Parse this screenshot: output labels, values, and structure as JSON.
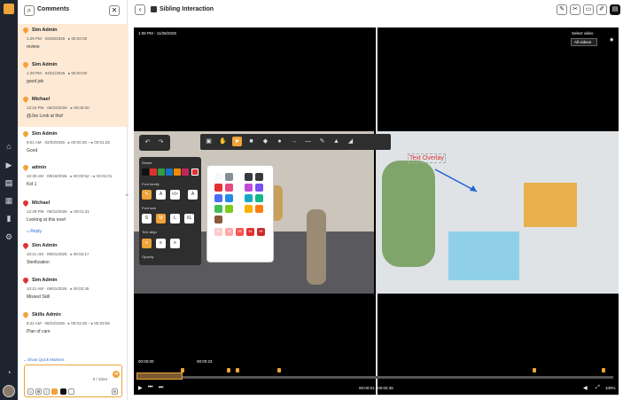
{
  "panel": {
    "title": "Comments",
    "close": "✕"
  },
  "comments": [
    {
      "name": "Sim Admin",
      "time": "1:29 PM · 02/25/2026",
      "range": "▸ 00:00:00",
      "text": "review",
      "color": "#f0a33a",
      "highlight": true
    },
    {
      "name": "Sim Admin",
      "time": "1:29 PM · 04/01/2026",
      "range": "▸ 00:00:00",
      "text": "good job",
      "color": "#f0a33a",
      "highlight": true
    },
    {
      "name": "Michael",
      "time": "12:42 PM · 06/22/2026",
      "range": "▸ 00:00:00",
      "text": "@Joe Look at this!",
      "color": "#f0a33a",
      "highlight": true
    },
    {
      "name": "Sim Admin",
      "time": "9:01 AM · 02/03/2026",
      "range": "▸ 00:00:25 – ▸ 00:01:25",
      "text": "Good",
      "color": "#f0a33a",
      "highlight": false
    },
    {
      "name": "admin",
      "time": "10:30 AM · 08/19/2026",
      "range": "▸ 00:00:52 – ▸ 00:01:01",
      "text": "Kid 1",
      "color": "#f0a33a",
      "highlight": false
    },
    {
      "name": "Michael",
      "time": "12:39 PM · 06/22/2026",
      "range": "▸ 00:01:31",
      "text": "Looking at this now!",
      "color": "#d33",
      "highlight": false
    },
    {
      "name": "Sim Admin",
      "time": "10:21 AM · 09/01/2026",
      "range": "▸ 00:02:17",
      "text": "Sterilization",
      "color": "#d33",
      "highlight": false
    },
    {
      "name": "Sim Admin",
      "time": "10:21 AM · 09/01/2026",
      "range": "▸ 00:02:45",
      "text": "Missed Skill",
      "color": "#d33",
      "highlight": false
    },
    {
      "name": "Skills Admin",
      "time": "8:22 AM · 08/24/2026",
      "range": "▸ 00:03:48 – ▸ 00:03:56",
      "text": "Plan of care",
      "color": "#f0a33a",
      "highlight": false
    }
  ],
  "edited": "edited",
  "reply": "⤷ Reply",
  "quick_markers": "⌄ Show Quick Markers",
  "composer": {
    "count": "0 / 1024",
    "send": "➜"
  },
  "header": {
    "title": "Sibling Interaction"
  },
  "video": {
    "timestamp": "1:08 PM - 11/28/2025",
    "select_video": "Select video",
    "all_videos": "All videos",
    "overlay_text": "Text Overlay",
    "label_start": "00:00:00",
    "label_end": "00:00:23",
    "time_current": "00:00:01",
    "time_total": "00:04:36",
    "zoom": "100%"
  },
  "style_panel": {
    "stroke": "Stroke",
    "font_family": "Font family",
    "font_size": "Font size",
    "text_align": "Text align",
    "opacity": "Opacity",
    "sizes": [
      "S",
      "M",
      "L",
      "XL"
    ],
    "stroke_colors": [
      "#111111",
      "#e03131",
      "#2f9e44",
      "#1971c2",
      "#f08c00",
      "#c2255c"
    ]
  },
  "palette": {
    "values": [
      "91",
      "92",
      "93",
      "94",
      "95"
    ],
    "colors": [
      "#f8f9fa",
      "#868e96",
      "#343a40",
      "#343a40",
      "#e03131",
      "#e64980",
      "#be4bdb",
      "#7950f2",
      "#4c6ef5",
      "#228be6",
      "#15aabf",
      "#12b886",
      "#40c057",
      "#82c91e",
      "#fab005",
      "#fd7e14",
      "#8a5a3a",
      "#ffc9c9",
      "#ffa8a8",
      "#fa5252",
      "#e03131",
      "#c92a2a"
    ]
  }
}
